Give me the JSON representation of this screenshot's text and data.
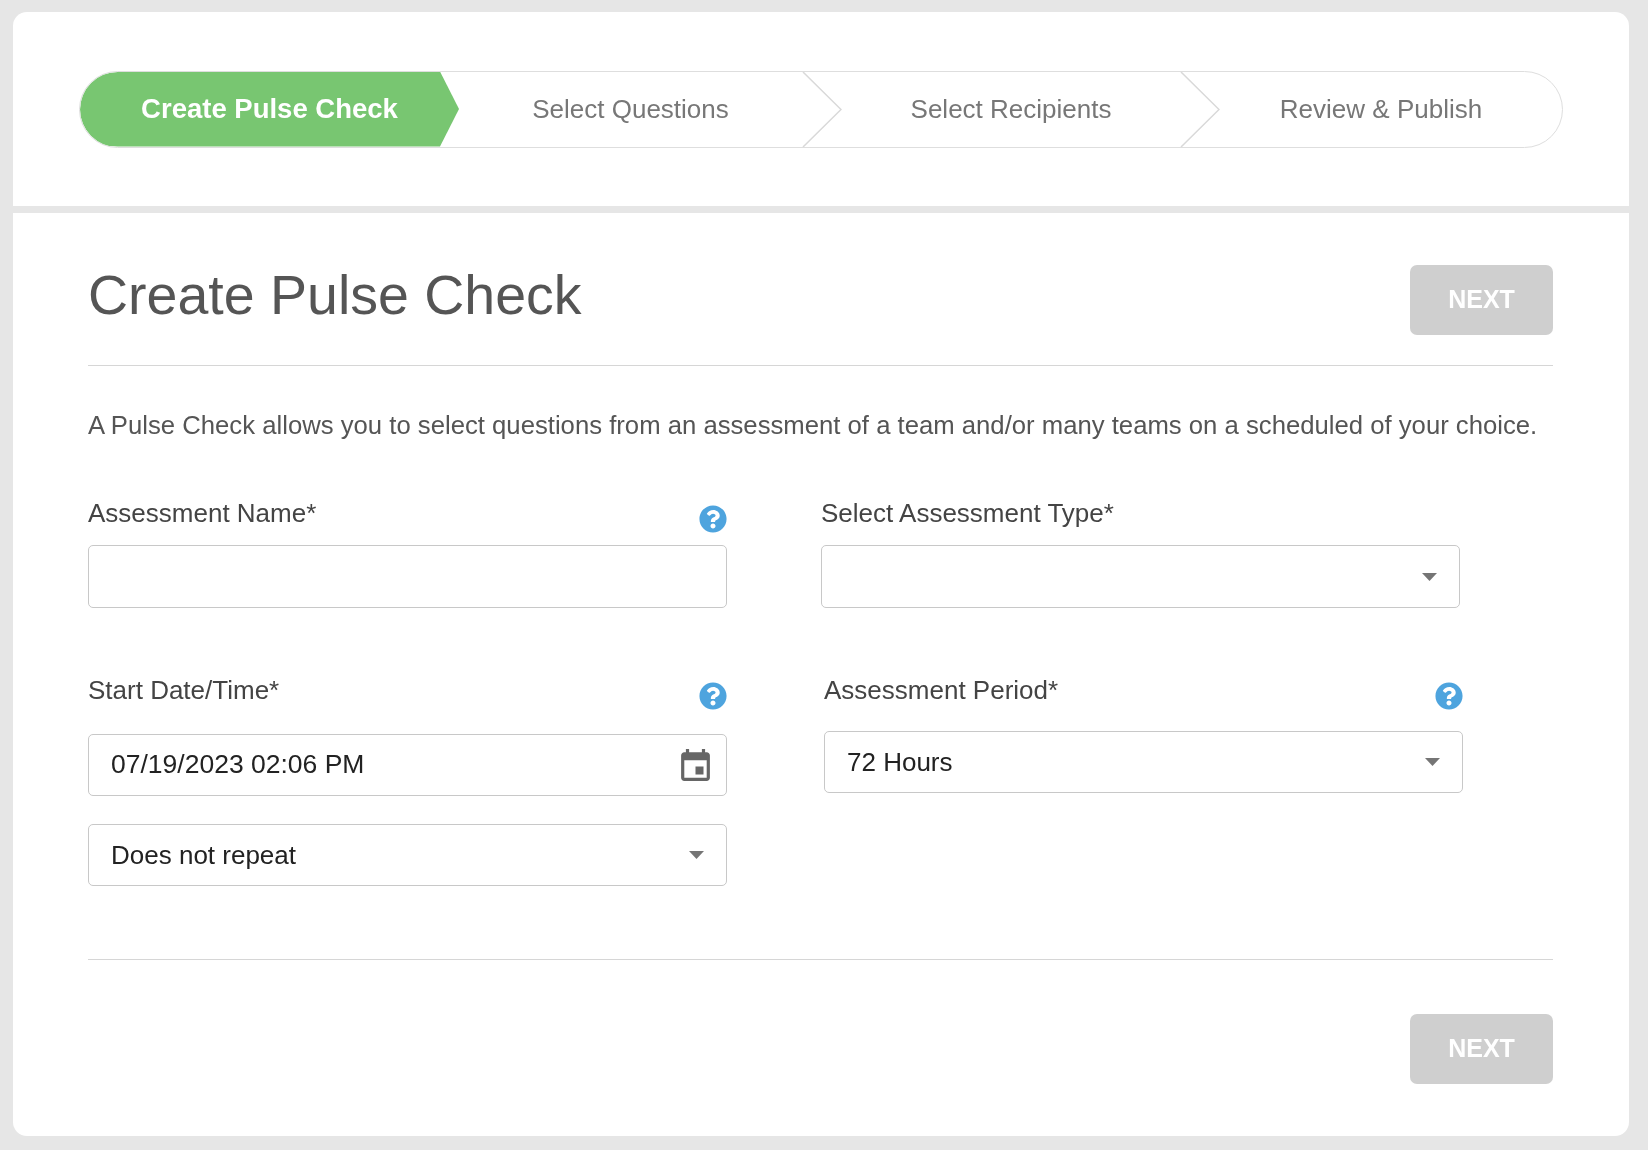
{
  "stepper": {
    "steps": [
      {
        "label": "Create Pulse Check",
        "selected": true
      },
      {
        "label": "Select Questions",
        "selected": false
      },
      {
        "label": "Select Recipients",
        "selected": false
      },
      {
        "label": "Review & Publish",
        "selected": false
      }
    ]
  },
  "header": {
    "title": "Create Pulse Check",
    "next_button": {
      "label": "NEXT",
      "disabled": true
    }
  },
  "description": "A Pulse Check allows you to select questions from an assessment of a team and/or many teams on a scheduled of your choice.",
  "form": {
    "assessment_name": {
      "label": "Assessment Name*",
      "help": true
    },
    "assessment_type": {
      "label": "Select Assessment Type*"
    },
    "start_date": {
      "label": "Start Date/Time*",
      "help": true,
      "value": "07/19/2023 02:06 PM"
    },
    "repeat": {
      "value": "Does not repeat"
    },
    "assessment_period": {
      "label": "Assessment Period*",
      "help": true,
      "value": "72 Hours"
    }
  },
  "footer": {
    "next_button": {
      "label": "NEXT",
      "disabled": true
    }
  }
}
